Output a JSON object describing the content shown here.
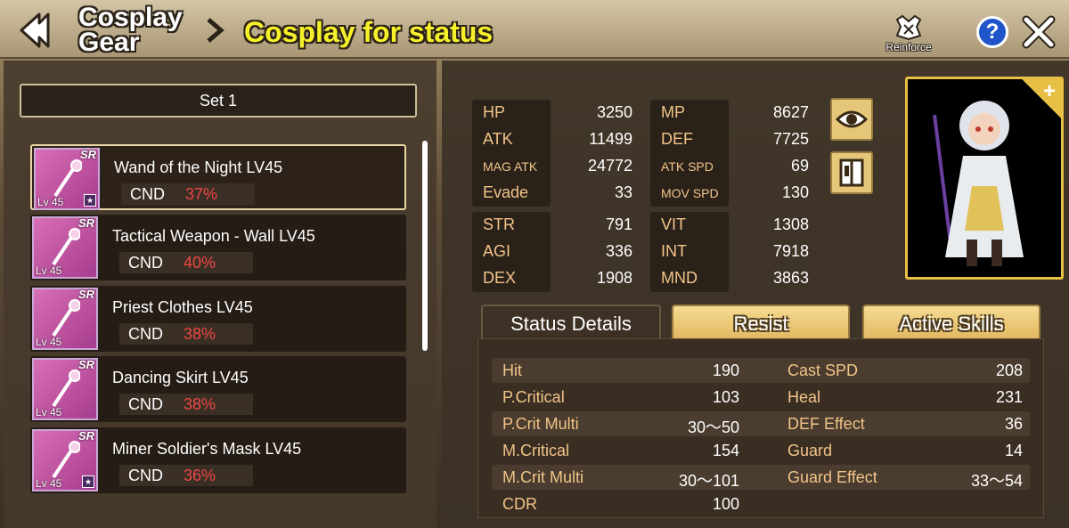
{
  "header": {
    "breadcrumb_line1": "Cosplay",
    "breadcrumb_line2": "Gear",
    "title": "Cosplay for status",
    "reinforce_label": "Reinforce",
    "help_label": "?"
  },
  "left": {
    "set_label": "Set 1",
    "gear": [
      {
        "name": "Wand of the Night LV45",
        "cnd_label": "CND",
        "cnd": "37%",
        "rarity": "SR",
        "level": "Lv 45",
        "icon": "wand-icon"
      },
      {
        "name": "Tactical Weapon - Wall LV45",
        "cnd_label": "CND",
        "cnd": "40%",
        "rarity": "SR",
        "level": "Lv 45",
        "icon": "shield-weapon-icon"
      },
      {
        "name": "Priest Clothes LV45",
        "cnd_label": "CND",
        "cnd": "38%",
        "rarity": "SR",
        "level": "Lv 45",
        "icon": "clothes-icon"
      },
      {
        "name": "Dancing Skirt LV45",
        "cnd_label": "CND",
        "cnd": "38%",
        "rarity": "SR",
        "level": "Lv 45",
        "icon": "skirt-icon"
      },
      {
        "name": "Miner Soldier's Mask LV45",
        "cnd_label": "CND",
        "cnd": "36%",
        "rarity": "SR",
        "level": "Lv 45",
        "icon": "mask-icon"
      }
    ]
  },
  "stats": {
    "group1_left": [
      {
        "label": "HP",
        "value": "3250"
      },
      {
        "label": "ATK",
        "value": "11499"
      },
      {
        "label": "MAG ATK",
        "value": "24772"
      },
      {
        "label": "Evade",
        "value": "33"
      }
    ],
    "group1_right": [
      {
        "label": "MP",
        "value": "8627"
      },
      {
        "label": "DEF",
        "value": "7725"
      },
      {
        "label": "ATK SPD",
        "value": "69"
      },
      {
        "label": "MOV SPD",
        "value": "130"
      }
    ],
    "group2_left": [
      {
        "label": "STR",
        "value": "791"
      },
      {
        "label": "AGI",
        "value": "336"
      },
      {
        "label": "DEX",
        "value": "1908"
      }
    ],
    "group2_right": [
      {
        "label": "VIT",
        "value": "1308"
      },
      {
        "label": "INT",
        "value": "7918"
      },
      {
        "label": "MND",
        "value": "3863"
      }
    ]
  },
  "tabs": [
    "Status Details",
    "Resist",
    "Active Skills"
  ],
  "details": [
    {
      "l_label": "Hit",
      "l_value": "190",
      "r_label": "Cast SPD",
      "r_value": "208"
    },
    {
      "l_label": "P.Critical",
      "l_value": "103",
      "r_label": "Heal",
      "r_value": "231"
    },
    {
      "l_label": "P.Crit Multi",
      "l_value": "30～50",
      "r_label": "DEF Effect",
      "r_value": "36"
    },
    {
      "l_label": "M.Critical",
      "l_value": "154",
      "r_label": "Guard",
      "r_value": "14"
    },
    {
      "l_label": "M.Crit Multi",
      "l_value": "30～101",
      "r_label": "Guard Effect",
      "r_value": "33～54"
    },
    {
      "l_label": "CDR",
      "l_value": "100",
      "r_label": "",
      "r_value": ""
    }
  ],
  "icons": {
    "back": "back-arrow-icon",
    "separator": "chevron-right-icon",
    "reinforce": "reinforce-icon",
    "help": "help-icon",
    "close": "close-icon",
    "view": "eye-icon",
    "wardrobe": "wardrobe-icon",
    "portrait_add": "plus-icon"
  },
  "colors": {
    "title": "#f6f02a",
    "stat_label": "#f2c48a",
    "cnd_value": "#ef4646",
    "tab_gold": "#e3b861",
    "portrait_border": "#e8bf45"
  }
}
